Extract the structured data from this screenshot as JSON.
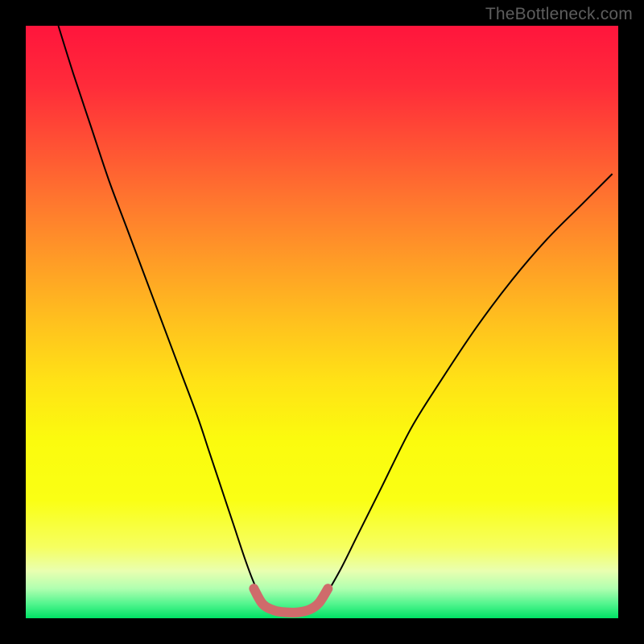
{
  "watermark": "TheBottleneck.com",
  "gradient": {
    "stops": [
      {
        "offset": 0.0,
        "color": "#ff153c"
      },
      {
        "offset": 0.1,
        "color": "#ff2b3a"
      },
      {
        "offset": 0.2,
        "color": "#ff5134"
      },
      {
        "offset": 0.3,
        "color": "#ff782e"
      },
      {
        "offset": 0.4,
        "color": "#ff9d26"
      },
      {
        "offset": 0.5,
        "color": "#ffc11e"
      },
      {
        "offset": 0.6,
        "color": "#ffe216"
      },
      {
        "offset": 0.7,
        "color": "#fbfb0e"
      },
      {
        "offset": 0.8,
        "color": "#faff14"
      },
      {
        "offset": 0.88,
        "color": "#f6ff60"
      },
      {
        "offset": 0.92,
        "color": "#e9ffb0"
      },
      {
        "offset": 0.95,
        "color": "#b0ffb0"
      },
      {
        "offset": 0.975,
        "color": "#55f58f"
      },
      {
        "offset": 1.0,
        "color": "#00e365"
      }
    ]
  },
  "chart_data": {
    "type": "line",
    "title": "",
    "xlabel": "",
    "ylabel": "",
    "xlim": [
      0,
      100
    ],
    "ylim": [
      0,
      100
    ],
    "grid": false,
    "series": [
      {
        "name": "bottleneck-curve",
        "color": "#000000",
        "x": [
          5.5,
          8,
          11,
          14,
          17,
          20,
          23,
          26,
          29,
          31,
          33,
          35,
          37,
          38.5,
          40,
          42,
          44,
          46,
          48,
          50,
          53,
          56,
          60,
          65,
          70,
          76,
          82,
          88,
          94,
          99
        ],
        "y": [
          100,
          92,
          83,
          74,
          66,
          58,
          50,
          42,
          34,
          28,
          22,
          16,
          10,
          6,
          3,
          1.2,
          0.6,
          0.6,
          1.0,
          3,
          8,
          14,
          22,
          32,
          40,
          49,
          57,
          64,
          70,
          75
        ]
      },
      {
        "name": "highlight-band",
        "color": "#cf6b6b",
        "stroke_width": 12,
        "linecap": "round",
        "x": [
          38.5,
          40,
          42,
          44,
          46,
          48,
          49.5,
          51
        ],
        "y": [
          5.0,
          2.4,
          1.3,
          1.0,
          1.0,
          1.5,
          2.6,
          5.0
        ]
      }
    ],
    "annotations": []
  }
}
